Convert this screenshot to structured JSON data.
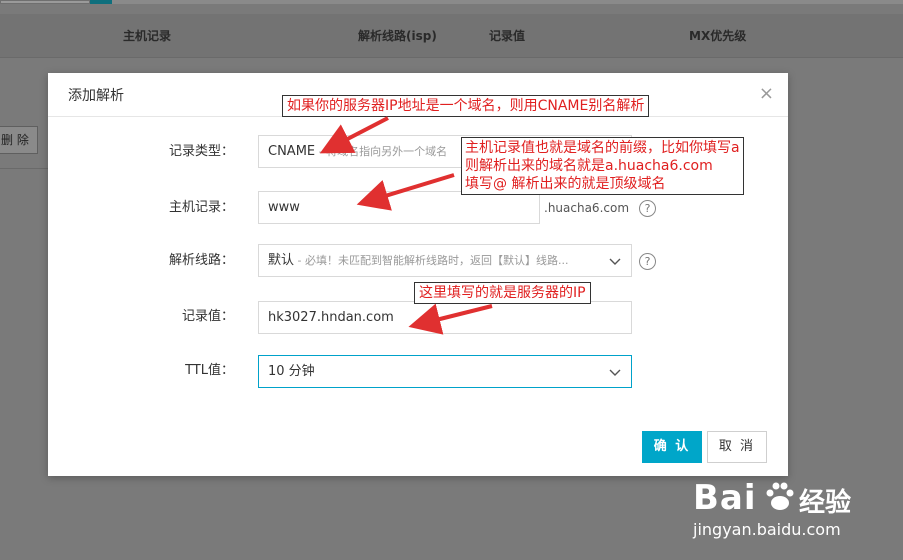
{
  "background": {
    "columns": [
      "主机记录",
      "解析线路(isp)",
      "记录值",
      "MX优先级"
    ],
    "delete_button": "删 除"
  },
  "modal": {
    "title": "添加解析",
    "close_icon": "close-icon",
    "fields": {
      "record_type": {
        "label": "记录类型：",
        "value": "CNAME",
        "hint": " - 将域名指向另外一个域名"
      },
      "host_record": {
        "label": "主机记录：",
        "value": "www",
        "suffix": ".huacha6.com"
      },
      "line": {
        "label": "解析线路：",
        "value": "默认",
        "hint": " - 必填！未匹配到智能解析线路时，返回【默认】线路..."
      },
      "record_value": {
        "label": "记录值：",
        "value": "hk3027.hndan.com"
      },
      "ttl": {
        "label": "TTL值：",
        "value": "10 分钟"
      }
    },
    "buttons": {
      "confirm": "确 认",
      "cancel": "取 消"
    }
  },
  "annotations": {
    "note1": "如果你的服务器IP地址是一个域名，则用CNAME别名解析",
    "note2_lines": [
      "主机记录值也就是域名的前缀，比如你填写a",
      "则解析出来的域名就是a.huacha6.com",
      "填写@  解析出来的就是顶级域名"
    ],
    "note3": "这里填写的就是服务器的IP"
  },
  "watermark": {
    "brand": "Bai",
    "brand2": "经验",
    "url": "jingyan.baidu.com"
  },
  "colors": {
    "accent": "#00a6c9",
    "annotation": "#e02020",
    "overlay": "#7f7f7f"
  }
}
